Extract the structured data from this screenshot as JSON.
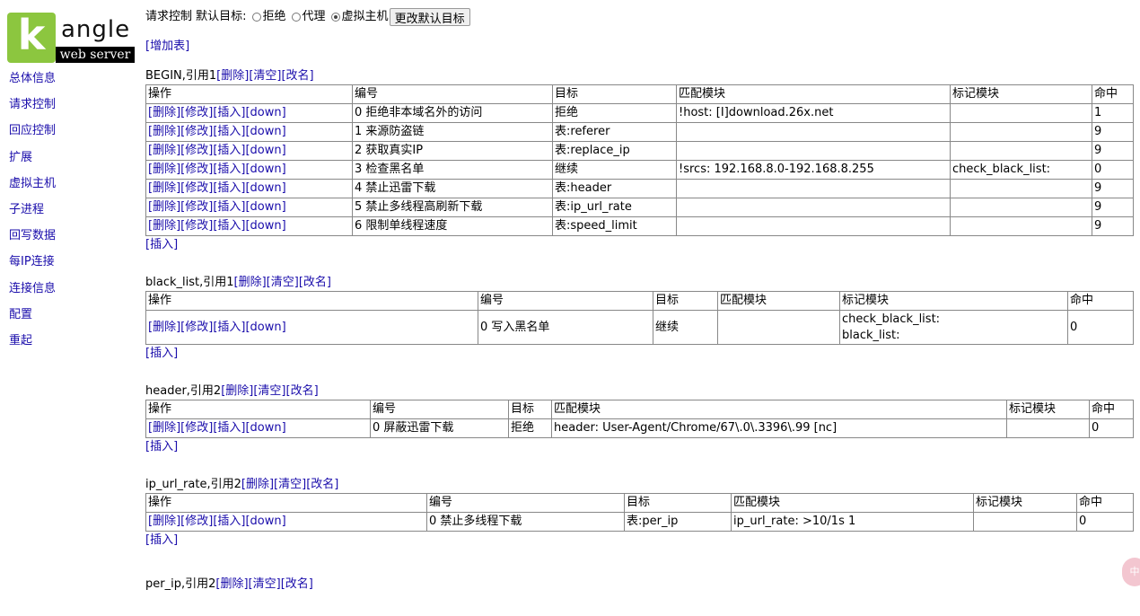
{
  "logo": {
    "letter": "k",
    "word": "angle",
    "sub": "web server",
    "accent": "#8cc63f"
  },
  "nav": [
    "总体信息",
    "请求控制",
    "回应控制",
    "扩展",
    "虚拟主机",
    "子进程",
    "回写数据",
    "每IP连接",
    "连接信息",
    "配置",
    "重起"
  ],
  "topbar": {
    "label": "请求控制 默认目标:",
    "options": [
      "拒绝",
      "代理",
      "虚拟主机"
    ],
    "selected": "虚拟主机",
    "button": "更改默认目标"
  },
  "add_table": "[增加表]",
  "actions": {
    "del": "[删除]",
    "edit": "[修改]",
    "insert": "[插入]",
    "down": "[down]",
    "clear": "[清空]",
    "rename": "[改名]"
  },
  "columns": [
    "操作",
    "编号",
    "目标",
    "匹配模块",
    "标记模块",
    "命中"
  ],
  "tables": [
    {
      "name": "BEGIN,引用1",
      "rows": [
        {
          "id": "0 拒绝非本域名外的访问",
          "target": "拒绝",
          "match": "!host: [I]download.26x.net",
          "mark": "",
          "hit": "1"
        },
        {
          "id": "1 来源防盗链",
          "target": "表:referer",
          "match": "",
          "mark": "",
          "hit": "9"
        },
        {
          "id": "2 获取真实IP",
          "target": "表:replace_ip",
          "match": "",
          "mark": "",
          "hit": "9"
        },
        {
          "id": "3 检查黑名单",
          "target": "继续",
          "match": "!srcs: 192.168.8.0-192.168.8.255",
          "mark": "check_black_list:",
          "hit": "0"
        },
        {
          "id": "4 禁止迅雷下载",
          "target": "表:header",
          "match": "",
          "mark": "",
          "hit": "9"
        },
        {
          "id": "5 禁止多线程高刷新下载",
          "target": "表:ip_url_rate",
          "match": "",
          "mark": "",
          "hit": "9"
        },
        {
          "id": "6 限制单线程速度",
          "target": "表:speed_limit",
          "match": "",
          "mark": "",
          "hit": "9"
        }
      ]
    },
    {
      "name": "black_list,引用1",
      "rows": [
        {
          "id": "0 写入黑名单",
          "target": "继续",
          "match": "",
          "mark": "check_black_list:\nblack_list:",
          "mark1": "check_black_list:",
          "mark2": "black_list:",
          "hit": "0"
        }
      ]
    },
    {
      "name": "header,引用2",
      "rows": [
        {
          "id": "0 屏蔽迅雷下载",
          "target": "拒绝",
          "match": "header: User-Agent/Chrome/67\\.0\\.3396\\.99 [nc]",
          "mark": "",
          "hit": "0"
        }
      ]
    },
    {
      "name": "ip_url_rate,引用2",
      "rows": [
        {
          "id": "0 禁止多线程下载",
          "target": "表:per_ip",
          "match": "ip_url_rate: >10/1s 1",
          "mark": "",
          "hit": "0"
        }
      ]
    },
    {
      "name": "per_ip,引用2",
      "rows": []
    }
  ],
  "badge": "中"
}
